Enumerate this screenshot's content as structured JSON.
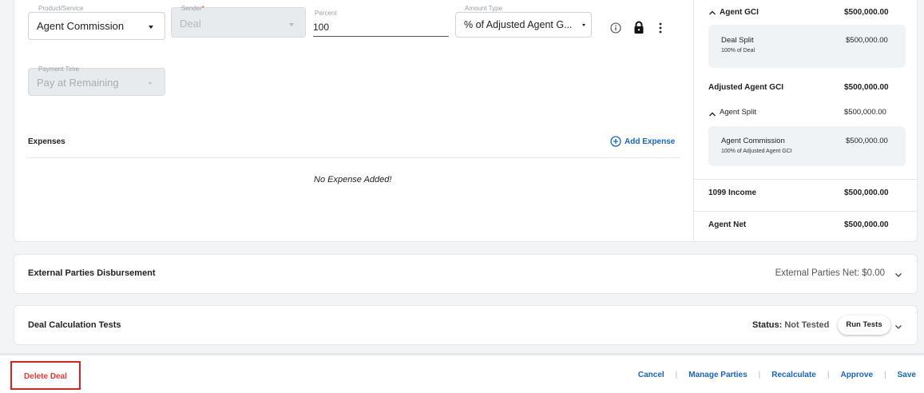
{
  "commission": {
    "product_service": {
      "label": "Product/Service",
      "value": "Agent Commission"
    },
    "sender": {
      "label": "Sender",
      "required_mark": "*",
      "value": "Deal"
    },
    "percent": {
      "label": "Percent",
      "value": "100"
    },
    "amount_type": {
      "label": "Amount Type",
      "value": "% of Adjusted Agent G..."
    },
    "payment_time": {
      "label": "Payment Time",
      "value": "Pay at Remaining"
    }
  },
  "expenses": {
    "title": "Expenses",
    "add_label": "Add Expense",
    "empty_text": "No Expense Added!"
  },
  "summary": {
    "agent_gci": {
      "label": "Agent GCI",
      "value": "$500,000.00"
    },
    "deal_split": {
      "label": "Deal Split",
      "sub": "100% of Deal",
      "value": "$500,000.00"
    },
    "adjusted_agent_gci": {
      "label": "Adjusted Agent GCI",
      "value": "$500,000.00"
    },
    "agent_split": {
      "label": "Agent Split",
      "value": "$500,000.00"
    },
    "agent_commission": {
      "label": "Agent Commission",
      "sub": "100% of Adjusted Agent GCI",
      "value": "$500,000.00"
    },
    "income_1099": {
      "label": "1099 Income",
      "value": "$500,000.00"
    },
    "agent_net": {
      "label": "Agent Net",
      "value": "$500,000.00"
    }
  },
  "external_parties": {
    "title": "External Parties Disbursement",
    "net_label": "External Parties Net: $0.00"
  },
  "calc_tests": {
    "title": "Deal Calculation Tests",
    "status_label": "Status:",
    "status_value": "Not Tested",
    "run_button": "Run Tests"
  },
  "footer": {
    "delete": "Delete Deal",
    "cancel": "Cancel",
    "manage_parties": "Manage Parties",
    "recalculate": "Recalculate",
    "approve": "Approve",
    "save": "Save",
    "separator": "|"
  },
  "colors": {
    "link": "#1565c0",
    "danger": "#e53935",
    "highlight_border": "#e02020"
  }
}
